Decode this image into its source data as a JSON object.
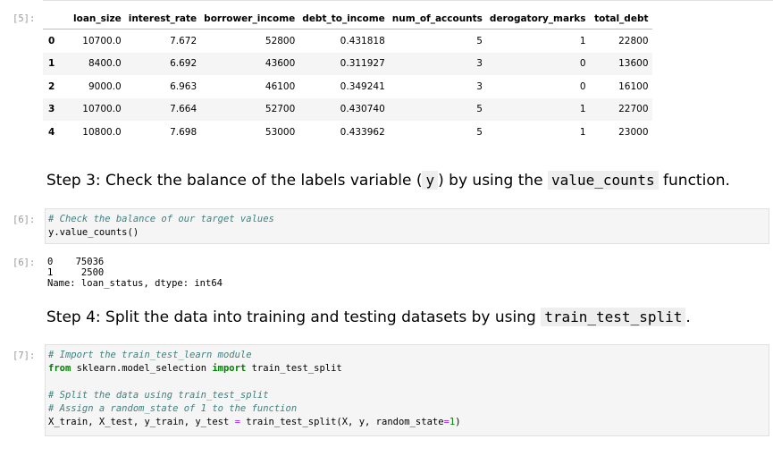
{
  "cell5": {
    "prompt": "[5]:",
    "columns": [
      "",
      "loan_size",
      "interest_rate",
      "borrower_income",
      "debt_to_income",
      "num_of_accounts",
      "derogatory_marks",
      "total_debt"
    ],
    "rows": [
      [
        "0",
        "10700.0",
        "7.672",
        "52800",
        "0.431818",
        "5",
        "1",
        "22800"
      ],
      [
        "1",
        "8400.0",
        "6.692",
        "43600",
        "0.311927",
        "3",
        "0",
        "13600"
      ],
      [
        "2",
        "9000.0",
        "6.963",
        "46100",
        "0.349241",
        "3",
        "0",
        "16100"
      ],
      [
        "3",
        "10700.0",
        "7.664",
        "52700",
        "0.430740",
        "5",
        "1",
        "22700"
      ],
      [
        "4",
        "10800.0",
        "7.698",
        "53000",
        "0.433962",
        "5",
        "1",
        "23000"
      ]
    ]
  },
  "step3": {
    "pre": "Step 3: Check the balance of the labels variable (",
    "code1": "y",
    "mid": ") by using the ",
    "code2": "value_counts",
    "post": " function."
  },
  "cell6": {
    "prompt": "[6]:",
    "lines": [
      "# Check the balance of our target values",
      "y.value_counts()"
    ],
    "out_prompt": "[6]:",
    "output": [
      "0    75036",
      "1     2500",
      "Name: loan_status, dtype: int64"
    ]
  },
  "step4": {
    "pre": "Step 4: Split the data into training and testing datasets by using ",
    "code1": "train_test_split",
    "post": "."
  },
  "cell7": {
    "prompt": "[7]:",
    "c1": "# Import the train_test_learn module",
    "from": "from",
    "mod": " sklearn.model_selection ",
    "imp": "import",
    "name": " train_test_split",
    "c2": "# Split the data using train_test_split",
    "c3": "# Assign a random_state of 1 to the function",
    "l6a": "X_train, X_test, y_train, y_test ",
    "eq": "=",
    "l6b": " train_test_split(X, y, random_state",
    "eq2": "=",
    "num": "1",
    "close": ")"
  }
}
